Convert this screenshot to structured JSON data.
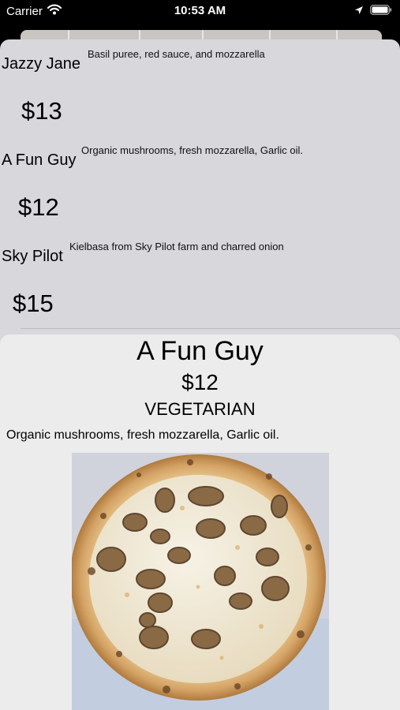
{
  "status_bar": {
    "carrier": "Carrier",
    "time": "10:53 AM"
  },
  "menu": {
    "items": [
      {
        "name": "Jazzy Jane",
        "description": "Basil puree, red sauce, and mozzarella",
        "price": "$13"
      },
      {
        "name": "A Fun Guy",
        "description": "Organic mushrooms, fresh mozzarella, Garlic oil.",
        "price": "$12"
      },
      {
        "name": "Sky Pilot",
        "description": "Kielbasa from Sky Pilot farm and charred onion",
        "price": "$15"
      }
    ]
  },
  "detail": {
    "title": "A Fun Guy",
    "price": "$12",
    "tag": "VEGETARIAN",
    "description": "Organic mushrooms, fresh mozzarella, Garlic oil.",
    "image": "mushroom-pizza-photo"
  },
  "colors": {
    "status_bar_bg": "#000000",
    "back_sheet_bg": "#d7d7dc",
    "front_sheet_bg": "#ececec"
  }
}
